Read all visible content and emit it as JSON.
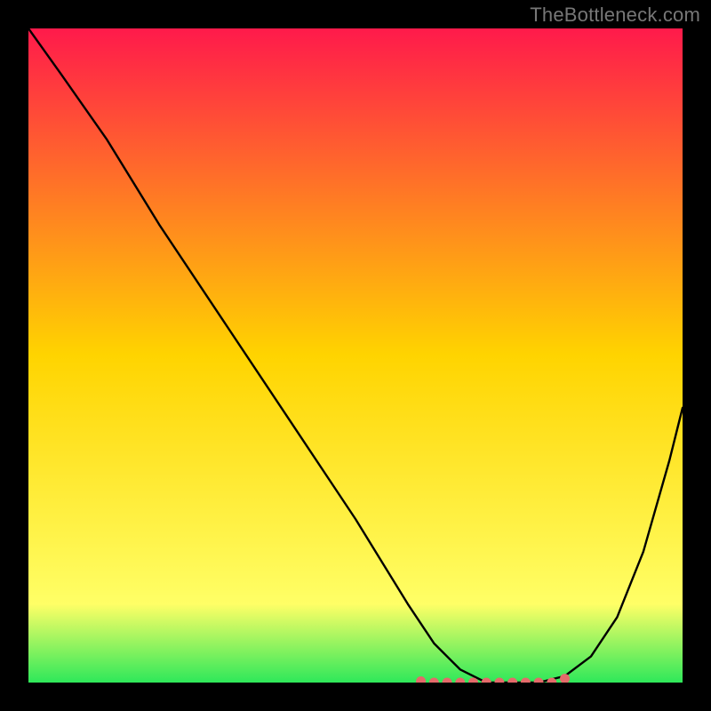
{
  "watermark": "TheBottleneck.com",
  "colors": {
    "frame_bg": "#000000",
    "grad_top": "#ff1a4b",
    "grad_mid": "#ffd400",
    "grad_band": "#ffff66",
    "grad_bottom": "#2ee85a",
    "curve": "#000000",
    "dots": "#e46a6a"
  },
  "chart_data": {
    "type": "line",
    "title": "",
    "xlabel": "",
    "ylabel": "",
    "xlim": [
      0,
      100
    ],
    "ylim": [
      0,
      100
    ],
    "grid": false,
    "legend": null,
    "series": [
      {
        "name": "bottleneck-curve",
        "x": [
          0,
          5,
          12,
          20,
          30,
          40,
          50,
          58,
          62,
          66,
          70,
          74,
          78,
          82,
          86,
          90,
          94,
          98,
          100
        ],
        "y": [
          100,
          93,
          83,
          70,
          55,
          40,
          25,
          12,
          6,
          2,
          0,
          0,
          0,
          1,
          4,
          10,
          20,
          34,
          42
        ]
      }
    ],
    "markers": {
      "name": "sweet-spot-dots",
      "x": [
        60,
        62,
        64,
        66,
        68,
        70,
        72,
        74,
        76,
        78,
        80,
        82
      ],
      "y": [
        0.2,
        -0.1,
        -0.4,
        -0.6,
        -0.8,
        -0.9,
        -0.9,
        -0.8,
        -0.6,
        -0.4,
        0,
        0.6
      ]
    },
    "annotations": []
  }
}
